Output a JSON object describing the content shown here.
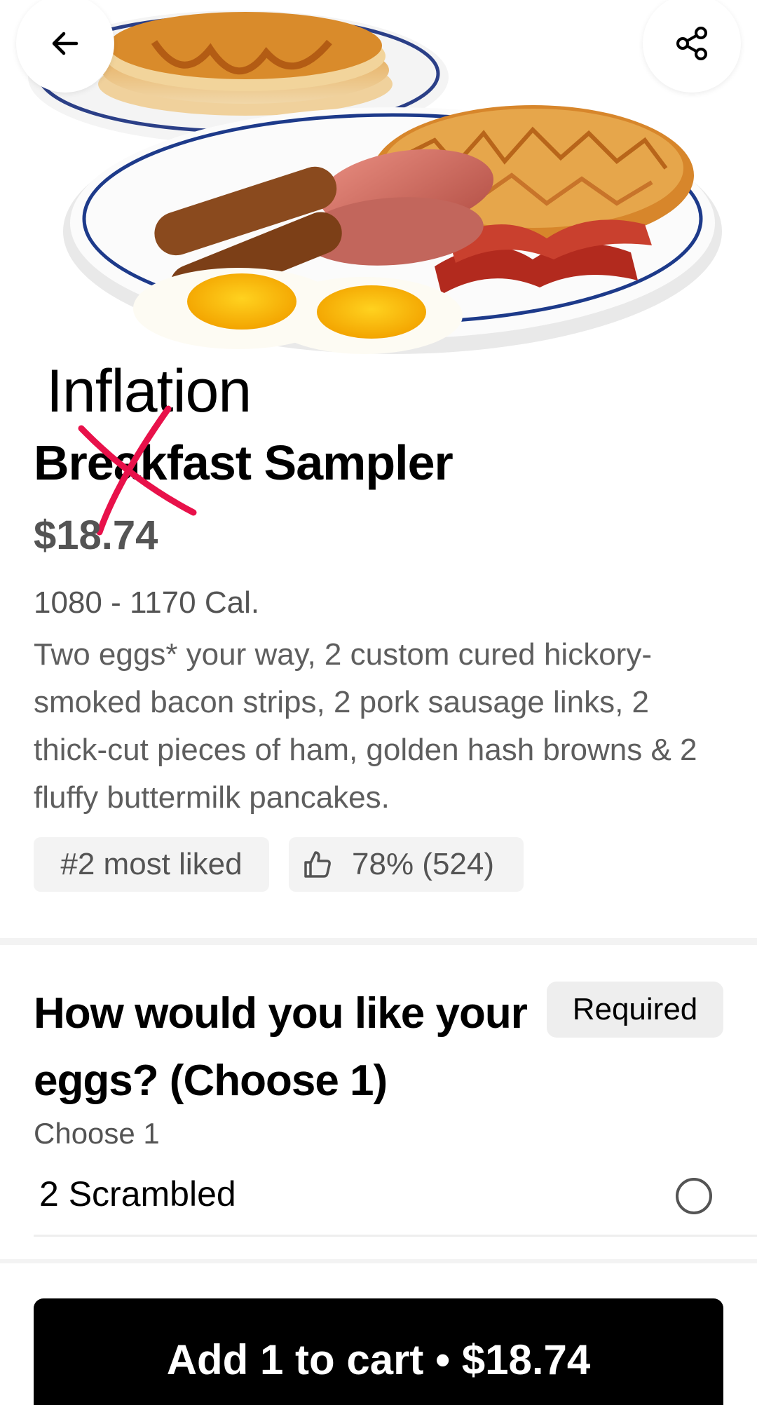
{
  "header": {
    "back_icon": "arrow-left-icon",
    "share_icon": "share-icon"
  },
  "annotation": {
    "handwritten_text": "Inflation",
    "strike_color": "#e8114a"
  },
  "item": {
    "title": "Breakfast Sampler",
    "price": "$18.74",
    "calories": "1080 - 1170 Cal.",
    "description": "Two eggs* your way, 2 custom cured hickory-smoked bacon strips, 2 pork sausage links, 2 thick-cut pieces of ham, golden hash browns & 2 fluffy buttermilk pancakes.",
    "rank_badge": "#2 most liked",
    "likes_badge": "78% (524)",
    "likes_icon": "thumbs-up-icon"
  },
  "options": {
    "title": "How would you like your eggs? (Choose 1)",
    "required_label": "Required",
    "subtitle": "Choose 1",
    "choices": [
      {
        "label": "2 Scrambled",
        "selected": false
      }
    ]
  },
  "cart": {
    "button_label": "Add 1 to cart  • $18.74"
  },
  "colors": {
    "primary": "#000000",
    "muted_text": "#545454",
    "chip_background": "#f3f3f3"
  }
}
